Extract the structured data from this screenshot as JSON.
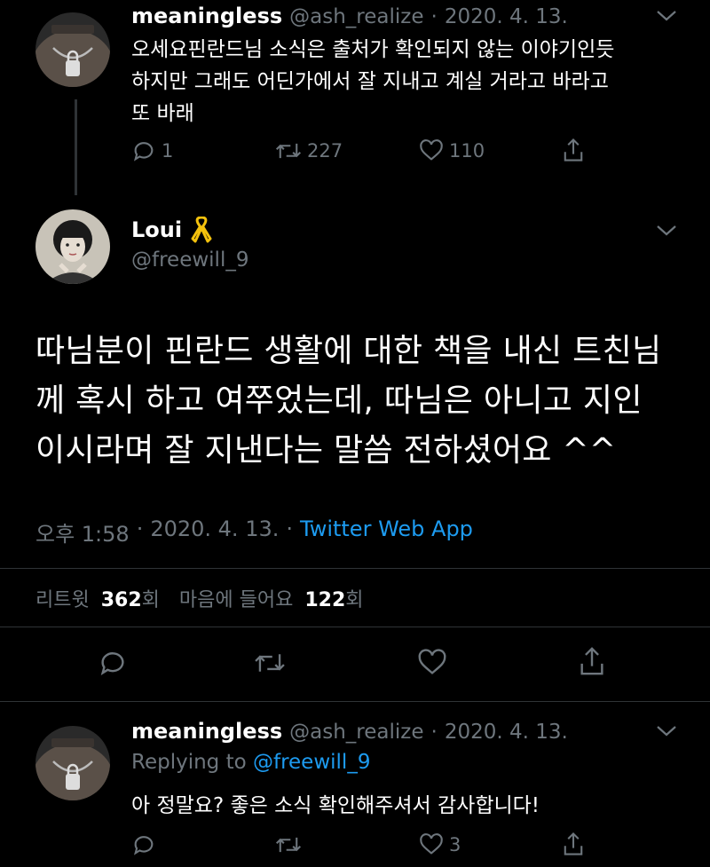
{
  "tweet1": {
    "name": "meaningless",
    "handle": "@ash_realize",
    "sep": "·",
    "date": "2020. 4. 13.",
    "text_line1": "오세요핀란드님 소식은 출처가 확인되지 않는 이야기인듯",
    "text_line2": "하지만 그래도 어딘가에서 잘 지내고 계실 거라고 바라고",
    "text_line3": "또 바래",
    "reply_count": "1",
    "retweet_count": "227",
    "like_count": "110"
  },
  "main": {
    "name": "Loui",
    "badge_icon": "yellow-ribbon-icon",
    "handle": "@freewill_9",
    "text_line1": "따님분이 핀란드 생활에 대한 책을 내신 트친님",
    "text_line2": "께 혹시 하고 여쭈었는데, 따님은 아니고 지인",
    "text_line3": "이시라며 잘 지낸다는 말씀 전하셨어요 ^^",
    "time": "오후 1:58",
    "sep": "·",
    "date": "2020. 4. 13.",
    "sep2": "·",
    "source": "Twitter Web App",
    "retweets_label": "리트윗",
    "retweets_count": "362",
    "retweets_unit": "회",
    "likes_label": "마음에 들어요",
    "likes_count": "122",
    "likes_unit": "회"
  },
  "tweet3": {
    "name": "meaningless",
    "handle": "@ash_realize",
    "sep": "·",
    "date": "2020. 4. 13.",
    "replying_to": "Replying to",
    "replying_handle": "@freewill_9",
    "text": "아 정말요? 좋은 소식 확인해주셔서 감사합니다!",
    "like_count": "3"
  },
  "colors": {
    "background": "#000000",
    "secondary_text": "#6e767d",
    "link": "#1d9bf0",
    "divider": "#2f3336",
    "ribbon": "#f4c20d"
  }
}
